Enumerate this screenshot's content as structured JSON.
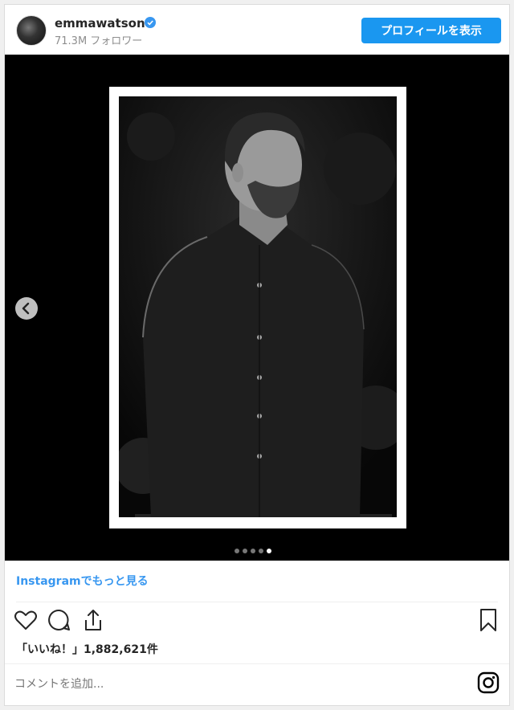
{
  "header": {
    "username": "emmawatson",
    "followers": "71.3M フォロワー",
    "follow_label": "プロフィールを表示"
  },
  "carousel": {
    "slide_count": 5,
    "active_index": 4
  },
  "more_link": "Instagramでもっと見る",
  "likes_text": "「いいね！」1,882,621件",
  "comment": {
    "placeholder": "コメントを追加..."
  },
  "colors": {
    "accent": "#1a97f0",
    "link": "#3897f0",
    "media_bg": "#000000"
  }
}
